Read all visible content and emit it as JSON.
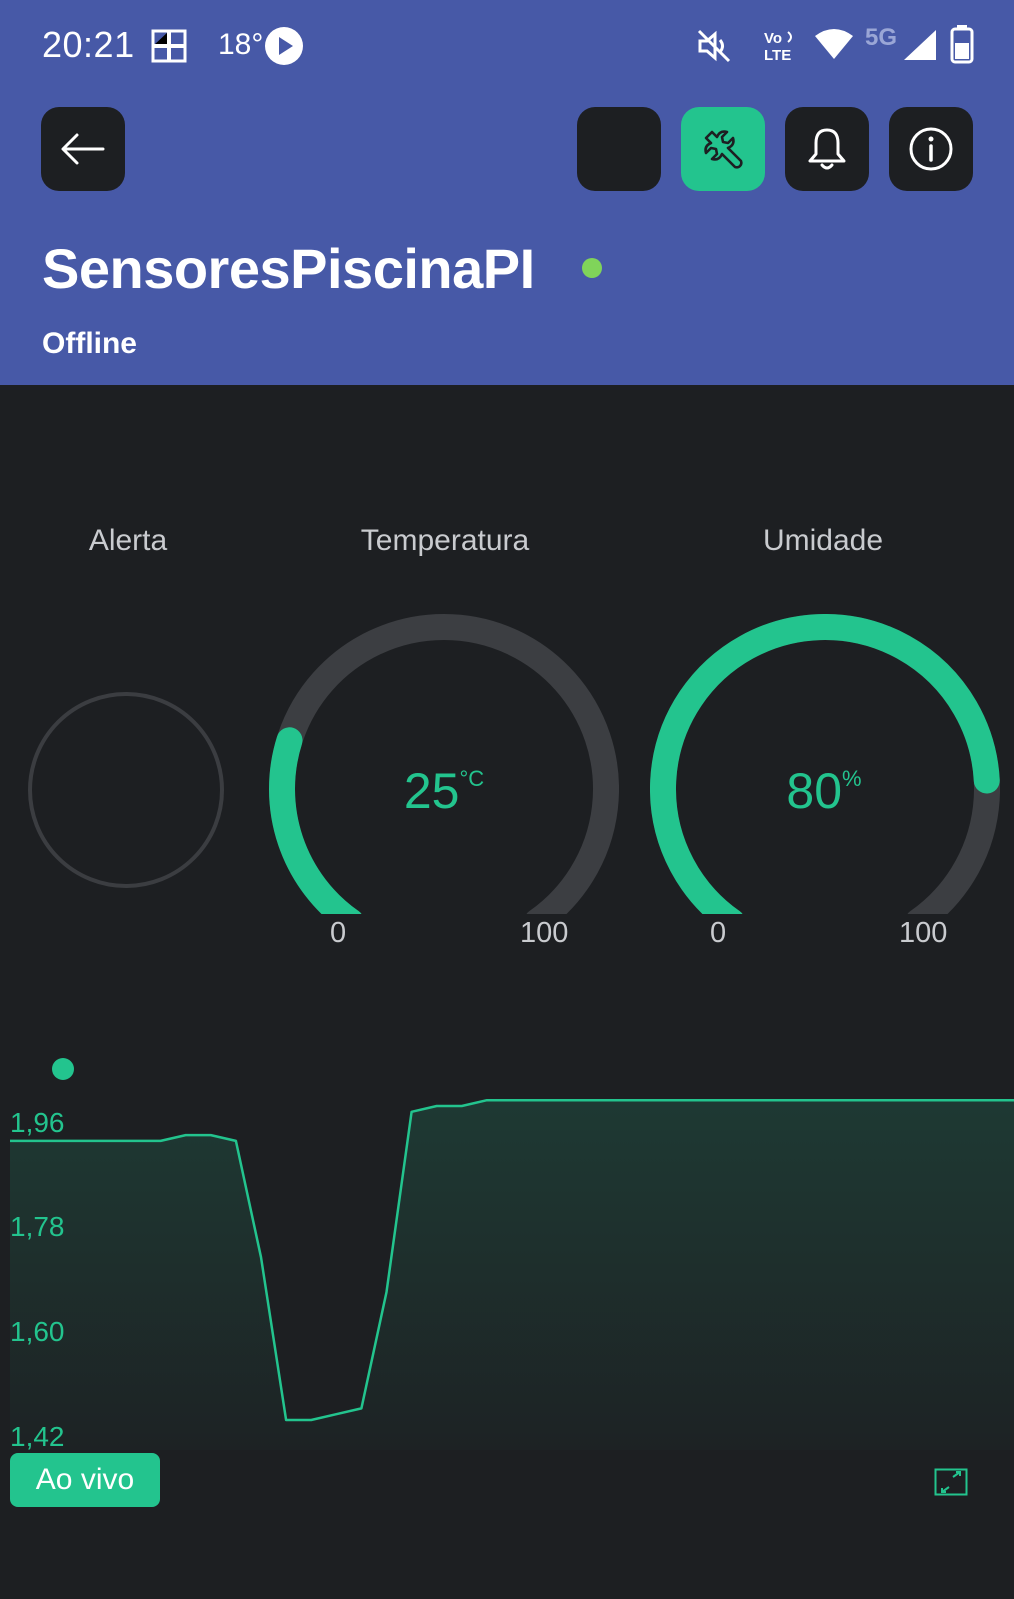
{
  "status_bar": {
    "time": "20:21",
    "temperature": "18°",
    "network": "5G",
    "icons": [
      "gallery-icon",
      "play-icon",
      "mute-icon",
      "volte-icon",
      "wifi-icon",
      "signal-icon",
      "battery-icon"
    ]
  },
  "toolbar": {
    "back_icon": "arrow-left-icon",
    "buttons": [
      "blank-button",
      "wrench-icon",
      "bell-icon",
      "info-icon"
    ],
    "active_color": "#23c48e"
  },
  "device": {
    "name": "SensoresPiscinaPI",
    "status": "Offline",
    "indicator_color": "#80d45a"
  },
  "widgets": {
    "alert": {
      "label": "Alerta"
    },
    "temperature": {
      "label": "Temperatura",
      "value": "25",
      "unit": "°C",
      "min": "0",
      "max": "100",
      "level": 25
    },
    "humidity": {
      "label": "Umidade",
      "value": "80",
      "unit": "%",
      "min": "0",
      "max": "100",
      "level": 80
    }
  },
  "chart": {
    "live_label": "Ao vivo",
    "yticks": [
      "1,96",
      "1,78",
      "1,60",
      "1,42"
    ]
  },
  "chart_data": {
    "type": "area",
    "ylim": [
      1.42,
      1.96
    ],
    "x": [
      0,
      1,
      2,
      3,
      4,
      5,
      6,
      7,
      8,
      9,
      10,
      11,
      12,
      13,
      14,
      15,
      16,
      17,
      18,
      19,
      20,
      21,
      22,
      23,
      24,
      25,
      26,
      27,
      28,
      29,
      30,
      31,
      32,
      33,
      34,
      35,
      36,
      37,
      38,
      39,
      40
    ],
    "values": [
      1.9,
      1.9,
      1.9,
      1.9,
      1.9,
      1.9,
      1.9,
      1.91,
      1.91,
      1.9,
      1.7,
      1.42,
      1.42,
      1.43,
      1.44,
      1.64,
      1.95,
      1.96,
      1.96,
      1.97,
      1.97,
      1.97,
      1.97,
      1.97,
      1.97,
      1.97,
      1.97,
      1.97,
      1.97,
      1.97,
      1.97,
      1.97,
      1.97,
      1.97,
      1.97,
      1.97,
      1.97,
      1.97,
      1.97,
      1.97,
      1.97
    ],
    "color": "#23c48e",
    "grid": false,
    "legend": "top-left"
  }
}
